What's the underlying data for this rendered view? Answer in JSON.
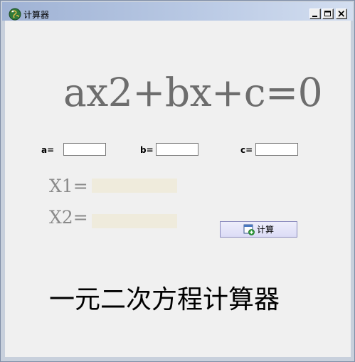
{
  "window": {
    "title": "计算器",
    "icon": "app-globe-icon",
    "controls": {
      "minimize_icon": "minimize-icon",
      "maximize_icon": "maximize-icon",
      "close_icon": "close-icon"
    }
  },
  "equation": {
    "text": "ax2+bx+c=0",
    "color": "#6d6d6d"
  },
  "coefficients": [
    {
      "label": "a=",
      "value": ""
    },
    {
      "label": "b=",
      "value": ""
    },
    {
      "label": "c=",
      "value": ""
    }
  ],
  "results": [
    {
      "label": "X1=",
      "value": ""
    },
    {
      "label": "X2=",
      "value": ""
    }
  ],
  "calculate_button": {
    "label": "计算",
    "icon": "calculate-icon"
  },
  "app_name": "一元二次方程计算器",
  "colors": {
    "client_background": "#f0f0f0",
    "result_field": "#efebdc",
    "button_border": "#8b8bbd",
    "titlebar": "#b9c9e4"
  }
}
